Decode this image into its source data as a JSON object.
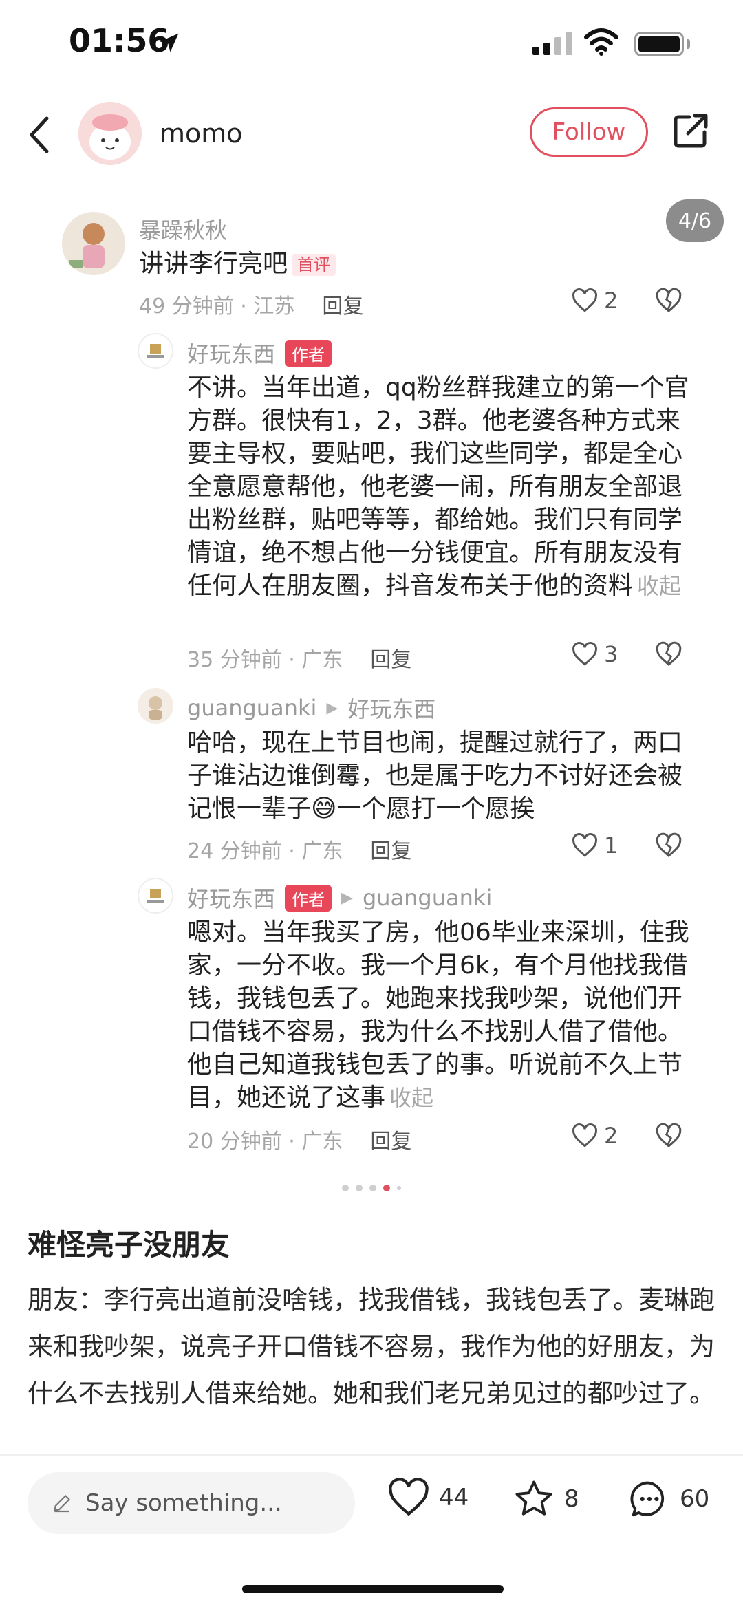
{
  "status_bar": {
    "time": "01:56"
  },
  "header": {
    "username": "momo",
    "follow_label": "Follow"
  },
  "carousel": {
    "counter": "4/6"
  },
  "comments": [
    {
      "name": "暴躁秋秋",
      "text": "讲讲李行亮吧",
      "badge": "首评",
      "time_loc": "49 分钟前 · 江苏",
      "reply_label": "回复",
      "likes": "2"
    },
    {
      "name": "好玩东西",
      "author_tag": "作者",
      "text": "不讲。当年出道，qq粉丝群我建立的第一个官方群。很快有1，2，3群。他老婆各种方式来要主导权，要贴吧，我们这些同学，都是全心全意愿意帮他，他老婆一闹，所有朋友全部退出粉丝群，贴吧等等，都给她。我们只有同学情谊，绝不想占他一分钱便宜。所有朋友没有任何人在朋友圈，抖音发布关于他的资料",
      "collapse": "收起",
      "time_loc": "35 分钟前 · 广东",
      "reply_label": "回复",
      "likes": "3"
    },
    {
      "name": "guanguanki",
      "reply_to": "好玩东西",
      "text_before": "哈哈，现在上节目也闹，提醒过就行了，两口子谁沾边谁倒霉，也是属于吃力不讨好还会被记恨一辈子",
      "emoji": "😅",
      "text_after": "一个愿打一个愿挨",
      "time_loc": "24 分钟前 · 广东",
      "reply_label": "回复",
      "likes": "1"
    },
    {
      "name": "好玩东西",
      "author_tag": "作者",
      "reply_to": "guanguanki",
      "text": "嗯对。当年我买了房，他06毕业来深圳，住我家，一分不收。我一个月6k，有个月他找我借钱，我钱包丢了。她跑来找我吵架，说他们开口借钱不容易，我为什么不找别人借了借他。他自己知道我钱包丢了的事。听说前不久上节目，她还说了这事",
      "collapse": "收起",
      "time_loc": "20 分钟前 · 广东",
      "reply_label": "回复",
      "likes": "2"
    }
  ],
  "post": {
    "title": "难怪亮子没朋友",
    "body": "朋友：李行亮出道前没啥钱，找我借钱，我钱包丢了。麦琳跑来和我吵架，说亮子开口借钱不容易，我作为他的好朋友，为什么不去找别人借来给她。她和我们老兄弟见过的都吵过了。"
  },
  "bottom_bar": {
    "input_placeholder": "Say something...",
    "likes": "44",
    "stars": "8",
    "comments": "60"
  },
  "colors": {
    "accent": "#e0505e",
    "muted": "#a5a5a5"
  }
}
